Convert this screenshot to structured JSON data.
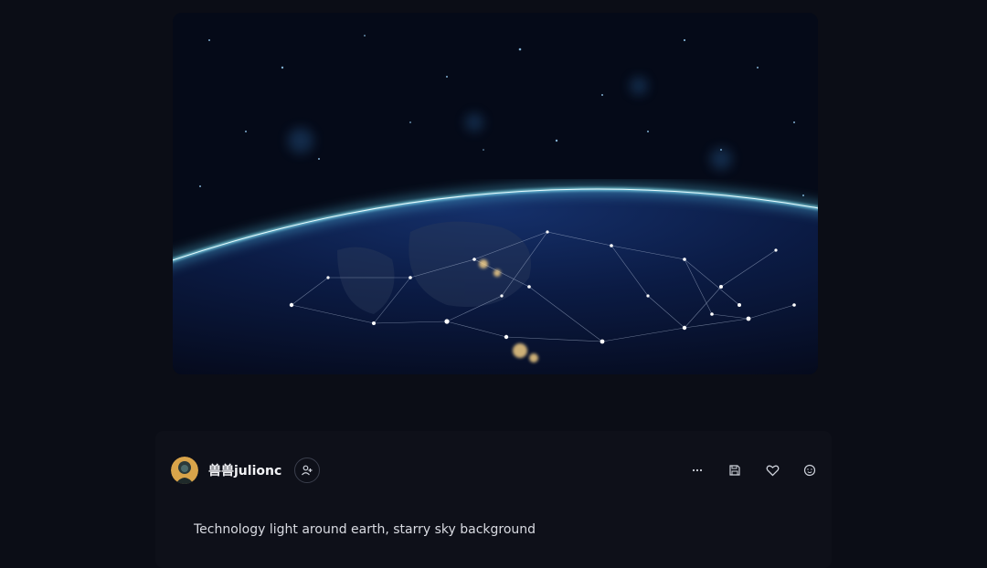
{
  "hero": {
    "icon": "earth-network-image"
  },
  "author": {
    "name": "兽兽julionc",
    "avatar_icon": "avatar-image",
    "follow_icon": "user-plus-icon"
  },
  "actions": {
    "more_icon": "more-icon",
    "save_icon": "save-icon",
    "like_icon": "heart-icon",
    "emoji_icon": "smiley-icon"
  },
  "post": {
    "caption": "Technology light around earth, starry sky background"
  },
  "colors": {
    "background": "#0b0d16",
    "card": "#0e1019",
    "atmosphere": "#5fd8ff"
  }
}
